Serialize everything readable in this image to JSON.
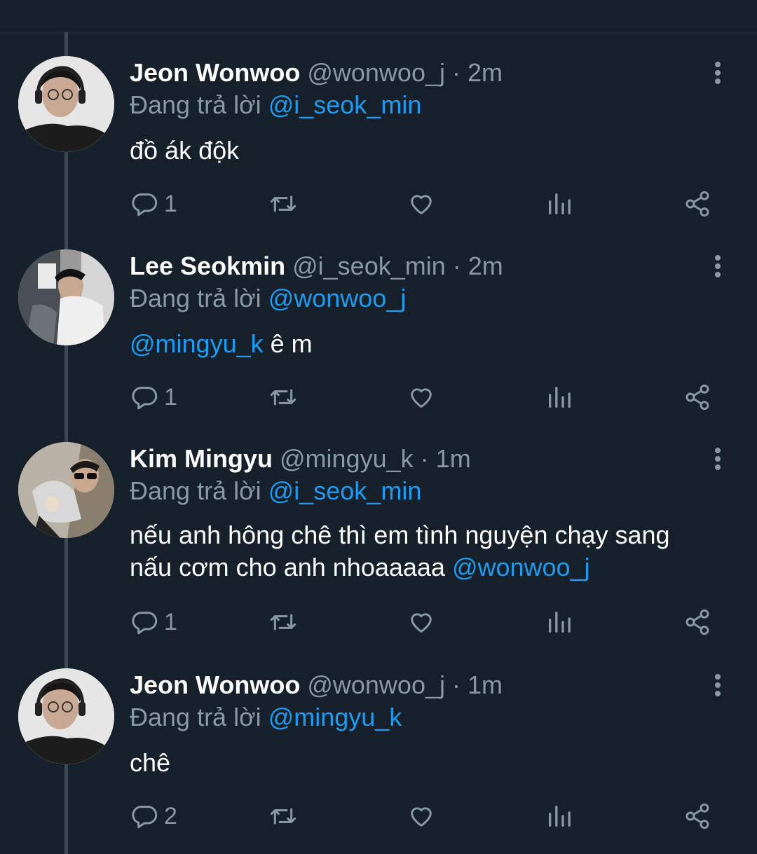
{
  "tweets": [
    {
      "name": "Jeon Wonwoo",
      "handle": "@wonwoo_j",
      "dot": "·",
      "time": "2m",
      "replying_prefix": "Đang trả lời",
      "replying_to": "@i_seok_min",
      "body_mention": "",
      "body_text": "đồ ák độk",
      "body_line2": "",
      "body_line2_mention": "",
      "reply_count": "1",
      "avatar": "person-with-headphones-and-glasses"
    },
    {
      "name": "Lee Seokmin",
      "handle": "@i_seok_min",
      "dot": "·",
      "time": "2m",
      "replying_prefix": "Đang trả lời",
      "replying_to": "@wonwoo_j",
      "body_mention": "@mingyu_k",
      "body_text": " ê m",
      "body_line2": "",
      "body_line2_mention": "",
      "reply_count": "1",
      "avatar": "person-in-cap-leaning"
    },
    {
      "name": "Kim Mingyu",
      "handle": "@mingyu_k",
      "dot": "·",
      "time": "1m",
      "replying_prefix": "Đang trả lời",
      "replying_to": "@i_seok_min",
      "body_mention": "",
      "body_text": "nếu anh hông chê thì em tình nguyện chạy sang",
      "body_line2": "nấu cơm cho anh nhoaaaaa ",
      "body_line2_mention": "@wonwoo_j",
      "reply_count": "1",
      "avatar": "person-in-sunglasses-crouching"
    },
    {
      "name": "Jeon Wonwoo",
      "handle": "@wonwoo_j",
      "dot": "·",
      "time": "1m",
      "replying_prefix": "Đang trả lời",
      "replying_to": "@mingyu_k",
      "body_mention": "",
      "body_text": "chê",
      "body_line2": "",
      "body_line2_mention": "",
      "reply_count": "2",
      "avatar": "person-with-headphones-and-glasses"
    }
  ],
  "icons": {
    "reply": "reply-icon",
    "retweet": "retweet-icon",
    "like": "heart-icon",
    "views": "analytics-icon",
    "share": "share-icon",
    "more": "more-options-icon"
  },
  "colors": {
    "background": "#15202b",
    "secondary_text": "#8899a6",
    "mention": "#1d9bf0",
    "thread_line": "#3d4854"
  }
}
